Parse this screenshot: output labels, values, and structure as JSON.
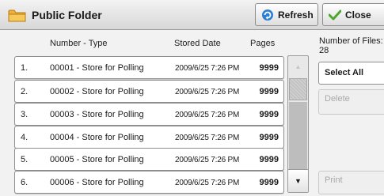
{
  "window": {
    "title": "Public Folder",
    "refresh_label": "Refresh",
    "close_label": "Close"
  },
  "table": {
    "headers": {
      "number_type": "Number - Type",
      "stored_date": "Stored Date",
      "pages": "Pages"
    },
    "rows": [
      {
        "index": "1.",
        "name": "00001 - Store for Polling",
        "date": "2009/6/25 7:26 PM",
        "pages": "9999"
      },
      {
        "index": "2.",
        "name": "00002 - Store for Polling",
        "date": "2009/6/25 7:26 PM",
        "pages": "9999"
      },
      {
        "index": "3.",
        "name": "00003 - Store for Polling",
        "date": "2009/6/25 7:26 PM",
        "pages": "9999"
      },
      {
        "index": "4.",
        "name": "00004 - Store for Polling",
        "date": "2009/6/25 7:26 PM",
        "pages": "9999"
      },
      {
        "index": "5.",
        "name": "00005 - Store for Polling",
        "date": "2009/6/25 7:26 PM",
        "pages": "9999"
      },
      {
        "index": "6.",
        "name": "00006 - Store for Polling",
        "date": "2009/6/25 7:26 PM",
        "pages": "9999"
      }
    ]
  },
  "side_panel": {
    "files_label": "Number of Files:",
    "files_count": "28",
    "select_all_label": "Select All",
    "delete_label": "Delete",
    "print_label": "Print"
  },
  "scrollbar": {
    "up_symbol": "▲",
    "down_symbol": "▼"
  },
  "colors": {
    "title_bar": "#e4e4e4",
    "folder_icon": "#f0b13a",
    "refresh_icon": "#2a7fd4",
    "close_icon": "#4fa82e",
    "disabled_text": "#a8a8a8"
  },
  "icons": {
    "title": "folder-icon",
    "refresh": "refresh-icon",
    "close": "checkmark-icon"
  }
}
